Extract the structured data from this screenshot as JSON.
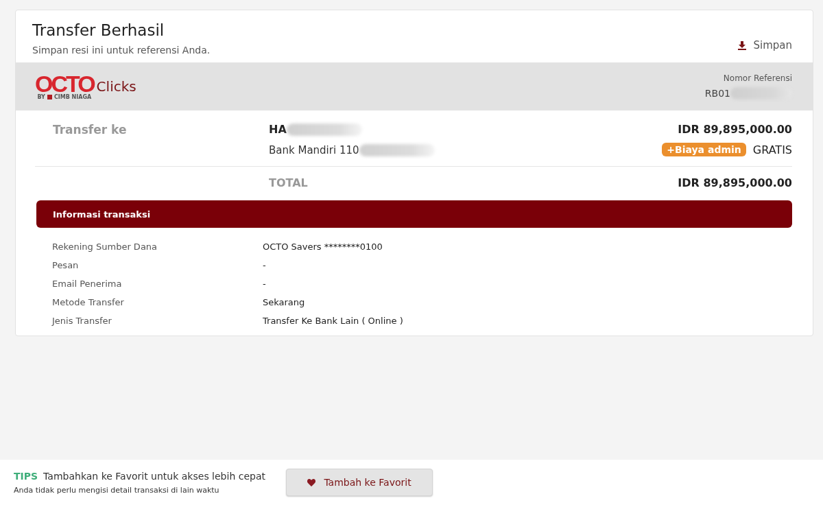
{
  "header": {
    "title": "Transfer Berhasil",
    "subtitle": "Simpan resi ini untuk referensi Anda.",
    "save_label": "Simpan"
  },
  "brand": {
    "logo": "OCTO",
    "product": "Clicks",
    "by": "BY",
    "bank": "CIMB NIAGA"
  },
  "reference": {
    "label": "Nomor Referensi",
    "value": "RB01",
    "redacted": true
  },
  "transfer": {
    "label": "Transfer ke",
    "name": "HA",
    "name_redacted": true,
    "account": "Bank Mandiri 110",
    "account_redacted": true,
    "amount": "IDR 89,895,000.00",
    "fee_badge": "+Biaya admin",
    "fee_value": "GRATIS"
  },
  "total": {
    "label": "TOTAL",
    "amount": "IDR 89,895,000.00"
  },
  "info": {
    "title": "Informasi transaksi",
    "rows": [
      {
        "label": "Rekening Sumber Dana",
        "value": "OCTO Savers ********0100"
      },
      {
        "label": "Pesan",
        "value": "-"
      },
      {
        "label": "Email Penerima",
        "value": "-"
      },
      {
        "label": "Metode Transfer",
        "value": "Sekarang"
      },
      {
        "label": "Jenis Transfer",
        "value": "Transfer Ke Bank Lain ( Online )"
      }
    ]
  },
  "tips": {
    "tag": "TIPS",
    "headline": "Tambahkan ke Favorit untuk akses lebih cepat",
    "note": "Anda tidak perlu mengisi detail transaksi di lain waktu",
    "button": "Tambah ke Favorit"
  }
}
